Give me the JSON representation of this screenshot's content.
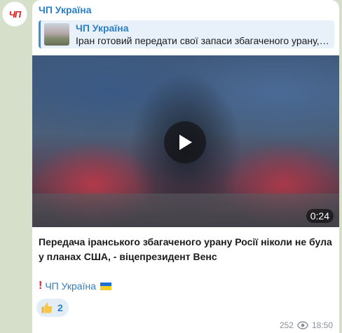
{
  "avatar": {
    "text": "ЧП"
  },
  "post": {
    "sender": "ЧП Україна",
    "reply": {
      "title": "ЧП Україна",
      "text": "Іран готовий передати свої запаси збагаченого урану,…"
    },
    "video": {
      "duration": "0:24"
    },
    "caption": "Передача іранського збагаченого урану Росії ніколи не була у планах США, - віцепрезидент Венс",
    "signature": {
      "text": "ЧП Україна"
    },
    "reaction": {
      "icon": "thumbs-up-icon",
      "count": "2"
    },
    "meta": {
      "views": "252",
      "time": "18:50"
    }
  },
  "colors": {
    "accent": "#2a7fc6",
    "background": "#d6dfc9",
    "bubble": "#ffffff"
  }
}
